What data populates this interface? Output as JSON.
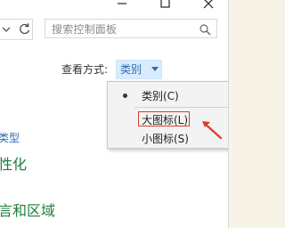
{
  "window": {
    "controls": {
      "minimize_icon": "minimize-icon",
      "maximize_icon": "maximize-icon",
      "close_icon": "close-icon"
    }
  },
  "address": {
    "dropdown_icon": "chevron-down-icon",
    "refresh_icon": "refresh-icon"
  },
  "search": {
    "placeholder": "搜索控制面板",
    "icon": "search-icon"
  },
  "view": {
    "label": "查看方式:",
    "selected": "类别"
  },
  "menu": {
    "items": [
      {
        "label": "类别(C)",
        "selected": true
      },
      {
        "label": "大图标(L)",
        "selected": false,
        "highlighted": true
      },
      {
        "label": "小图标(S)",
        "selected": false
      }
    ]
  },
  "sidebar_links": [
    {
      "text": "类型"
    },
    {
      "text": "性化"
    },
    {
      "text": "言和区域"
    }
  ],
  "annotation": {
    "color": "#e03a2d"
  }
}
